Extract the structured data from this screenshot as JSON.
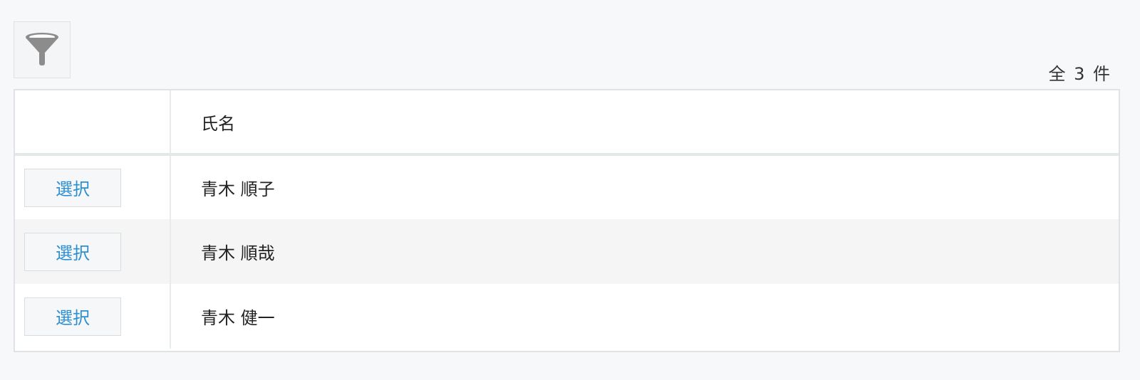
{
  "toolbar": {
    "filter_icon": "funnel-icon"
  },
  "result_count": "全 3 件",
  "table": {
    "columns": [
      "",
      "氏名"
    ],
    "rows": [
      {
        "action_label": "選択",
        "name": "青木 順子"
      },
      {
        "action_label": "選択",
        "name": "青木 順哉"
      },
      {
        "action_label": "選択",
        "name": "青木 健一"
      }
    ]
  },
  "colors": {
    "background": "#f7f8f9",
    "link_blue": "#2d8fd1",
    "border": "#dfe3e5",
    "row_alt": "#f5f5f5",
    "icon_gray": "#8c8c8c"
  }
}
